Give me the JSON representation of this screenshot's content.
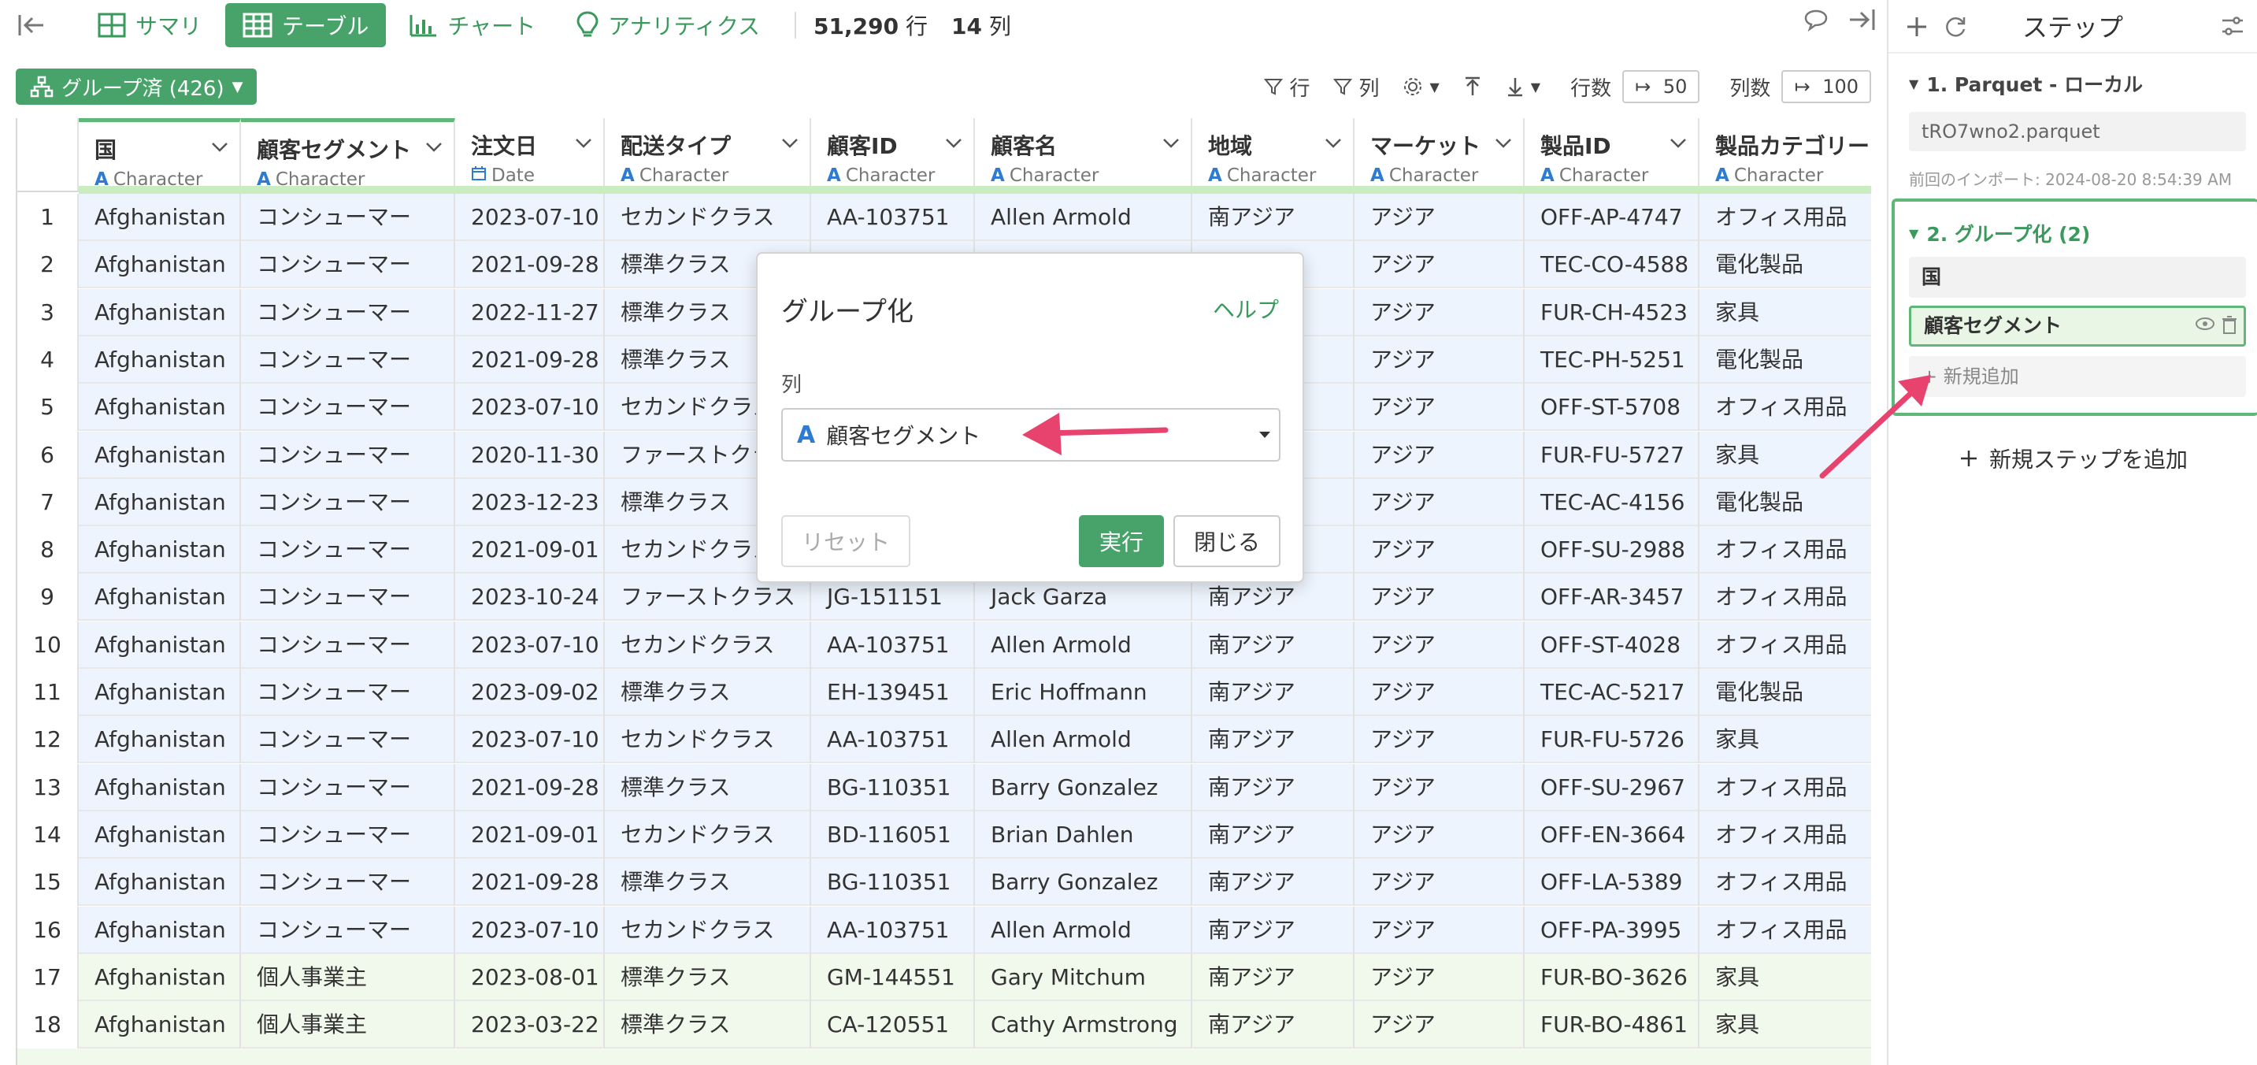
{
  "topbar": {
    "tabs": [
      {
        "label": "サマリ",
        "icon": "summary-grid-icon"
      },
      {
        "label": "テーブル",
        "icon": "table-icon",
        "active": true
      },
      {
        "label": "チャート",
        "icon": "bar-chart-icon"
      },
      {
        "label": "アナリティクス",
        "icon": "lightbulb-icon"
      }
    ],
    "rows_count": "51,290",
    "rows_unit": "行",
    "cols_count": "14",
    "cols_unit": "列"
  },
  "toolbar": {
    "group_button": "グループ済 (426)",
    "row_filter": "行",
    "col_filter": "列",
    "rows_label": "行数",
    "rows_limit": "50",
    "cols_label": "列数",
    "cols_limit": "100"
  },
  "columns": [
    {
      "name": "国",
      "type": "Character",
      "icon": "A"
    },
    {
      "name": "顧客セグメント",
      "type": "Character",
      "icon": "A"
    },
    {
      "name": "注文日",
      "type": "Date",
      "icon": "calendar"
    },
    {
      "name": "配送タイプ",
      "type": "Character",
      "icon": "A"
    },
    {
      "name": "顧客ID",
      "type": "Character",
      "icon": "A"
    },
    {
      "name": "顧客名",
      "type": "Character",
      "icon": "A"
    },
    {
      "name": "地域",
      "type": "Character",
      "icon": "A"
    },
    {
      "name": "マーケット",
      "type": "Character",
      "icon": "A"
    },
    {
      "name": "製品ID",
      "type": "Character",
      "icon": "A"
    },
    {
      "name": "製品カテゴリー",
      "type": "Character",
      "icon": "A"
    }
  ],
  "rows": [
    [
      "1",
      "Afghanistan",
      "コンシューマー",
      "2023-07-10",
      "セカンドクラス",
      "AA-103751",
      "Allen Armold",
      "南アジア",
      "アジア",
      "OFF-AP-4747",
      "オフィス用品"
    ],
    [
      "2",
      "Afghanistan",
      "コンシューマー",
      "2021-09-28",
      "標準クラス",
      "",
      "",
      "",
      "アジア",
      "TEC-CO-4588",
      "電化製品"
    ],
    [
      "3",
      "Afghanistan",
      "コンシューマー",
      "2022-11-27",
      "標準クラス",
      "",
      "",
      "",
      "アジア",
      "FUR-CH-4523",
      "家具"
    ],
    [
      "4",
      "Afghanistan",
      "コンシューマー",
      "2021-09-28",
      "標準クラス",
      "",
      "",
      "",
      "アジア",
      "TEC-PH-5251",
      "電化製品"
    ],
    [
      "5",
      "Afghanistan",
      "コンシューマー",
      "2023-07-10",
      "セカンドクラス",
      "",
      "",
      "",
      "アジア",
      "OFF-ST-5708",
      "オフィス用品"
    ],
    [
      "6",
      "Afghanistan",
      "コンシューマー",
      "2020-11-30",
      "ファーストクラス",
      "",
      "",
      "",
      "アジア",
      "FUR-FU-5727",
      "家具"
    ],
    [
      "7",
      "Afghanistan",
      "コンシューマー",
      "2023-12-23",
      "標準クラス",
      "",
      "",
      "",
      "アジア",
      "TEC-AC-4156",
      "電化製品"
    ],
    [
      "8",
      "Afghanistan",
      "コンシューマー",
      "2021-09-01",
      "セカンドクラス",
      "",
      "",
      "",
      "アジア",
      "OFF-SU-2988",
      "オフィス用品"
    ],
    [
      "9",
      "Afghanistan",
      "コンシューマー",
      "2023-10-24",
      "ファーストクラス",
      "JG-151151",
      "Jack Garza",
      "南アジア",
      "アジア",
      "OFF-AR-3457",
      "オフィス用品"
    ],
    [
      "10",
      "Afghanistan",
      "コンシューマー",
      "2023-07-10",
      "セカンドクラス",
      "AA-103751",
      "Allen Armold",
      "南アジア",
      "アジア",
      "OFF-ST-4028",
      "オフィス用品"
    ],
    [
      "11",
      "Afghanistan",
      "コンシューマー",
      "2023-09-02",
      "標準クラス",
      "EH-139451",
      "Eric Hoffmann",
      "南アジア",
      "アジア",
      "TEC-AC-5217",
      "電化製品"
    ],
    [
      "12",
      "Afghanistan",
      "コンシューマー",
      "2023-07-10",
      "セカンドクラス",
      "AA-103751",
      "Allen Armold",
      "南アジア",
      "アジア",
      "FUR-FU-5726",
      "家具"
    ],
    [
      "13",
      "Afghanistan",
      "コンシューマー",
      "2021-09-28",
      "標準クラス",
      "BG-110351",
      "Barry Gonzalez",
      "南アジア",
      "アジア",
      "OFF-SU-2967",
      "オフィス用品"
    ],
    [
      "14",
      "Afghanistan",
      "コンシューマー",
      "2021-09-01",
      "セカンドクラス",
      "BD-116051",
      "Brian Dahlen",
      "南アジア",
      "アジア",
      "OFF-EN-3664",
      "オフィス用品"
    ],
    [
      "15",
      "Afghanistan",
      "コンシューマー",
      "2021-09-28",
      "標準クラス",
      "BG-110351",
      "Barry Gonzalez",
      "南アジア",
      "アジア",
      "OFF-LA-5389",
      "オフィス用品"
    ],
    [
      "16",
      "Afghanistan",
      "コンシューマー",
      "2023-07-10",
      "セカンドクラス",
      "AA-103751",
      "Allen Armold",
      "南アジア",
      "アジア",
      "OFF-PA-3995",
      "オフィス用品"
    ],
    [
      "17",
      "Afghanistan",
      "個人事業主",
      "2023-08-01",
      "標準クラス",
      "GM-144551",
      "Gary Mitchum",
      "南アジア",
      "アジア",
      "FUR-BO-3626",
      "家具"
    ],
    [
      "18",
      "Afghanistan",
      "個人事業主",
      "2023-03-22",
      "標準クラス",
      "CA-120551",
      "Cathy Armstrong",
      "南アジア",
      "アジア",
      "FUR-BO-4861",
      "家具"
    ]
  ],
  "row_segments": [
    "seg1",
    "seg1",
    "seg1",
    "seg1",
    "seg1",
    "seg1",
    "seg1",
    "seg1",
    "seg1",
    "seg1",
    "seg1",
    "seg1",
    "seg1",
    "seg1",
    "seg1",
    "seg1",
    "seg2",
    "seg2"
  ],
  "dialog": {
    "title": "グループ化",
    "help": "ヘルプ",
    "column_label": "列",
    "selected_column": "顧客セグメント",
    "reset": "リセット",
    "run": "実行",
    "close": "閉じる"
  },
  "steps": {
    "title": "ステップ",
    "step1_label": "1. Parquet - ローカル",
    "file_name": "tRO7wno2.parquet",
    "last_import": "前回のインポート: 2024-08-20 8:54:39 AM",
    "step2_label": "2. グループ化 (2)",
    "group_items": [
      "国",
      "顧客セグメント"
    ],
    "new_add": "+ 新規追加",
    "add_step": "新規ステップを追加"
  },
  "colors": {
    "accent": "#47a369",
    "accent_text": "#3a9a5c",
    "arrow": "#e8436f",
    "group1_bg": "#eef4fd",
    "group2_bg": "#f1f8ec"
  }
}
